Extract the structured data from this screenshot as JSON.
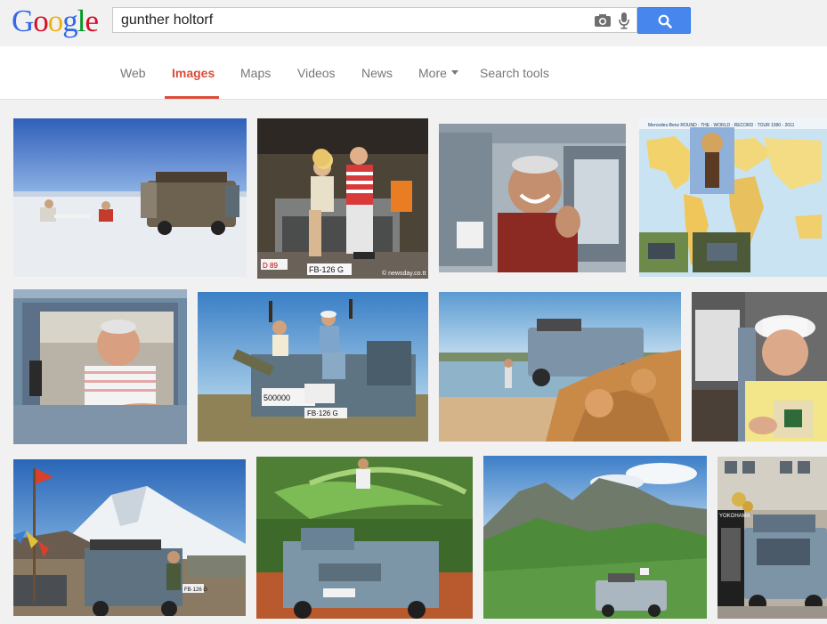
{
  "logo": {
    "letters": [
      {
        "ch": "G",
        "color": "#3369e8"
      },
      {
        "ch": "o",
        "color": "#d50f25"
      },
      {
        "ch": "o",
        "color": "#eeb211"
      },
      {
        "ch": "g",
        "color": "#3369e8"
      },
      {
        "ch": "l",
        "color": "#009925"
      },
      {
        "ch": "e",
        "color": "#d50f25"
      }
    ]
  },
  "search": {
    "query": "gunther holtorf"
  },
  "tabs": [
    {
      "label": "Web"
    },
    {
      "label": "Images"
    },
    {
      "label": "Maps"
    },
    {
      "label": "Videos"
    },
    {
      "label": "News"
    },
    {
      "label": "More"
    },
    {
      "label": "Search tools"
    }
  ],
  "results": [
    {
      "scene": "salt flat with Mercedes G-wagon and two people in chairs"
    },
    {
      "scene": "couple celebrating on Mercedes G-wagon hood, plate D-89, FB-126G, newsday.co.tt"
    },
    {
      "scene": "smiling man in G-wagon driver seat"
    },
    {
      "scene": "Round The World Record Tour 1990-2011 map"
    },
    {
      "scene": "man in white striped shirt in G-wagon window"
    },
    {
      "scene": "couple with bottles on G-wagon, signs 500000 and FB-126G"
    },
    {
      "scene": "G-wagon on rocky beach"
    },
    {
      "scene": "man in white hat holding a book"
    },
    {
      "scene": "G-wagon with Himalayas and prayer flags"
    },
    {
      "scene": "man on G-wagon under palm leaves"
    },
    {
      "scene": "G-wagon on green mountain ridge"
    },
    {
      "scene": "G-wagon on display at Yokohama stand"
    }
  ],
  "image_texts": {
    "plate_small": "D 89",
    "plate_main": "FB-126 G",
    "watermark": "© newsday.co.tt",
    "sign_500000": "500000",
    "plate_r2": "FB·126 G",
    "map_title": "Mercedes-Benz ROUND · THE · WORLD · RECORD · TOUR 1990 - 2011",
    "yokohama": "YOKOHAMA",
    "plate_r3": "FB·126 G"
  }
}
